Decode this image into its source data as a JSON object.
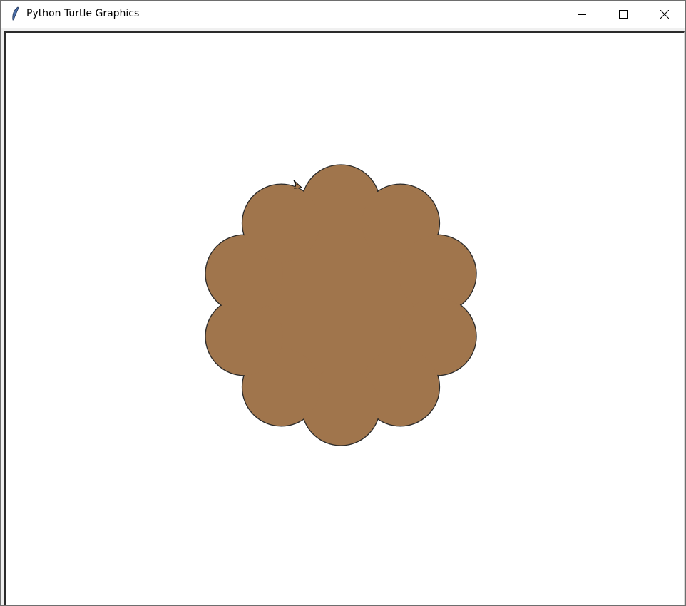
{
  "window": {
    "title": "Python Turtle Graphics"
  },
  "drawing": {
    "shape": "flower",
    "petal_count": 10,
    "fill_color": "#a0754c",
    "outline_color": "#2a2a2a",
    "turtle_color": "#000000"
  }
}
